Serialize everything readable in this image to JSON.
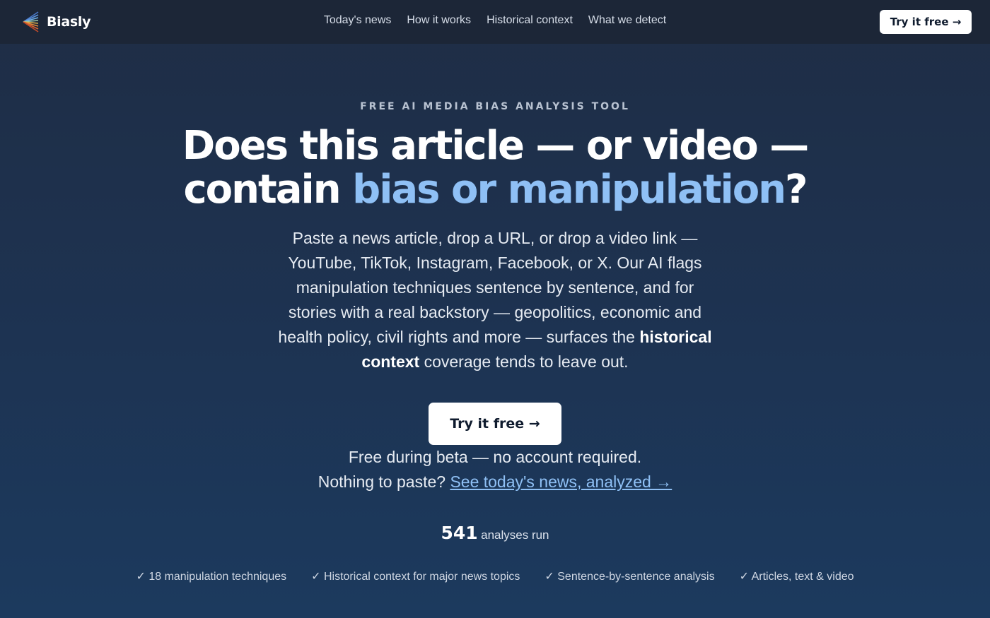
{
  "nav": {
    "brand": "Biasly",
    "links": [
      "Today's news",
      "How it works",
      "Historical context",
      "What we detect"
    ],
    "cta": "Try it free →"
  },
  "hero": {
    "eyebrow": "FREE AI MEDIA BIAS ANALYSIS TOOL",
    "headline_line1": "Does this article — or video —",
    "headline_line2_prefix": "contain ",
    "headline_accent": "bias or manipulation",
    "headline_suffix": "?",
    "subtext_before": "Paste a news article, drop a URL, or drop a video link — YouTube, TikTok, Instagram, Facebook, or X. Our AI flags manipulation techniques sentence by sentence, and for stories with a real backstory — geopolitics, economic and health policy, civil rights and more — surfaces the ",
    "subtext_bold": "historical context",
    "subtext_after": " coverage tends to leave out.",
    "cta": "Try it free →",
    "beta_note": "Free during beta — no account required.",
    "paste_prefix": "Nothing to paste? ",
    "paste_link": "See today's news, analyzed →"
  },
  "stats": {
    "count": "541",
    "label": "analyses run"
  },
  "features": [
    "✓ 18 manipulation techniques",
    "✓ Historical context for major news topics",
    "✓ Sentence-by-sentence analysis",
    "✓ Articles, text & video"
  ],
  "colors": {
    "accent": "#8fc0f5",
    "nav_bg": "#1c2637",
    "page_bg": "#1d3352"
  }
}
